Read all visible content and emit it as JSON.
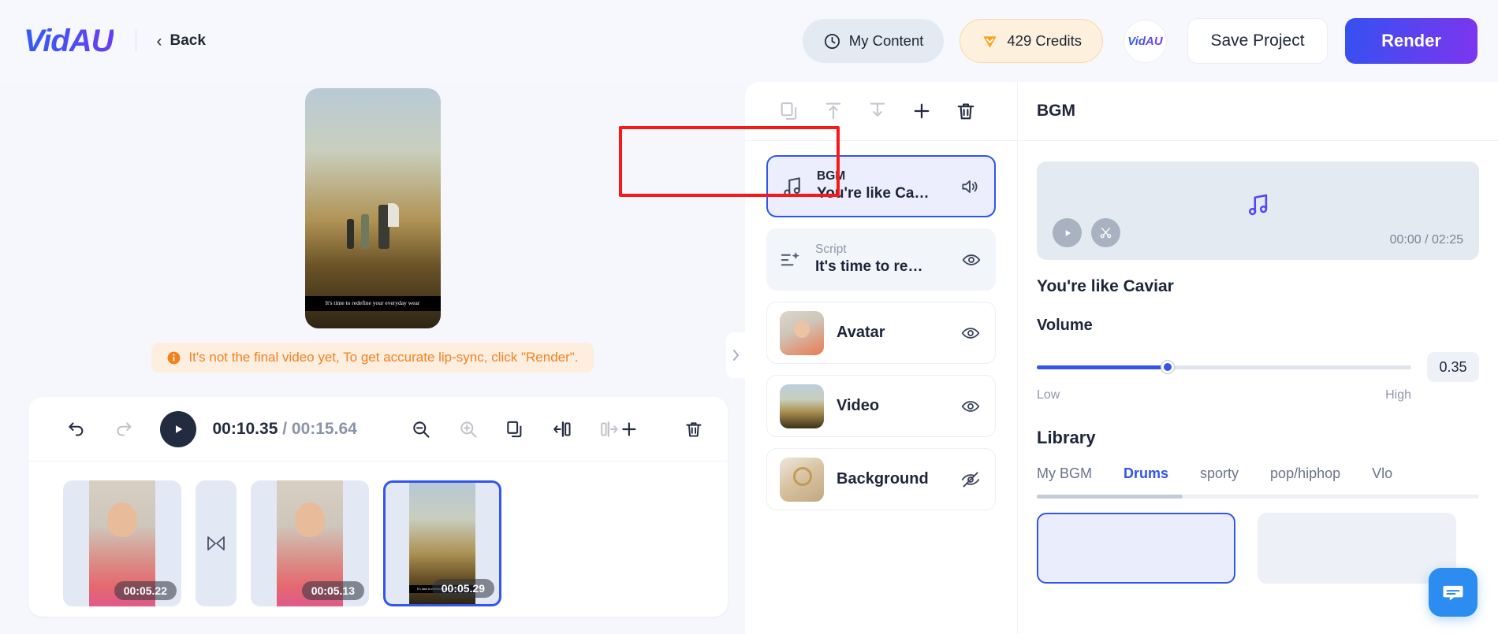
{
  "header": {
    "logo": "VidAU",
    "back_label": "Back",
    "my_content_label": "My Content",
    "credits_label": "429 Credits",
    "avatar_label": "VidAU",
    "save_label": "Save Project",
    "render_label": "Render",
    "accent_gradient_start": "#3551f0",
    "accent_gradient_end": "#7e35ee"
  },
  "preview": {
    "caption": "It's time to redefine your everyday wear",
    "notice": "It's not the final video yet, To get accurate lip-sync, click \"Render\".",
    "notice_color": "#f2821e"
  },
  "timeline": {
    "current_time": "00:10.35",
    "separator": "/",
    "total_time": "00:15.64",
    "icons": {
      "undo": "undo-icon",
      "redo": "redo-icon",
      "play": "play-icon",
      "zoom_out": "zoom-out-icon",
      "zoom_in": "zoom-in-icon",
      "duplicate": "duplicate-icon",
      "split_left": "split-left-icon",
      "split_right": "split-right-icon",
      "add": "plus-icon",
      "delete": "trash-icon"
    },
    "clips": [
      {
        "duration": "00:05.22",
        "kind": "avatar",
        "selected": false
      },
      {
        "duration": "00:05.13",
        "kind": "avatar",
        "selected": false
      },
      {
        "duration": "00:05.29",
        "kind": "video",
        "selected": true
      }
    ],
    "transition_label": "transition"
  },
  "layers_panel": {
    "toolbar": [
      "duplicate-icon",
      "move-up-icon",
      "move-down-icon",
      "plus-icon",
      "trash-icon"
    ],
    "items": [
      {
        "sub": "BGM",
        "title": "You're like Ca…",
        "icon": "music-note-icon",
        "action": "speaker-icon",
        "state": "selected",
        "highlighted": true
      },
      {
        "sub": "Script",
        "title": "It's time to re…",
        "icon": "script-icon",
        "action": "eye-icon",
        "state": "normal",
        "highlighted": false
      },
      {
        "sub": "",
        "title": "Avatar",
        "icon": "avatar-thumb",
        "action": "eye-icon",
        "state": "plain",
        "highlighted": false
      },
      {
        "sub": "",
        "title": "Video",
        "icon": "video-thumb",
        "action": "eye-icon",
        "state": "plain",
        "highlighted": false
      },
      {
        "sub": "",
        "title": "Background",
        "icon": "background-thumb",
        "action": "eye-off-icon",
        "state": "plain",
        "highlighted": false
      }
    ]
  },
  "properties": {
    "title": "BGM",
    "player": {
      "play": "play-icon",
      "trim": "scissors-icon",
      "time": "00:00 / 02:25"
    },
    "track_title": "You're like Caviar",
    "volume": {
      "label": "Volume",
      "value": "0.35",
      "percent": 35,
      "low_label": "Low",
      "high_label": "High",
      "accent": "#3355ec"
    },
    "library": {
      "title": "Library",
      "tabs": [
        {
          "label": "My BGM",
          "active": false
        },
        {
          "label": "Drums",
          "active": true
        },
        {
          "label": "sporty",
          "active": false
        },
        {
          "label": "pop/hiphop",
          "active": false
        },
        {
          "label": "Vlo",
          "active": false
        }
      ]
    }
  },
  "chat": {
    "icon": "chat-bubble-icon"
  }
}
